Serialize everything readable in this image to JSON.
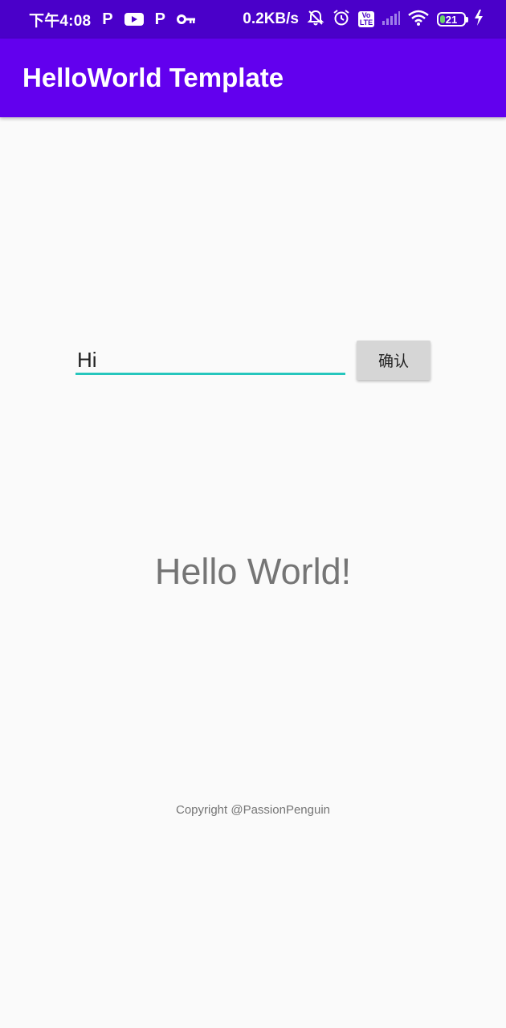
{
  "status_bar": {
    "time": "下午4:08",
    "left_icons": [
      {
        "icon": "p-app-icon",
        "glyph": "P"
      },
      {
        "icon": "youtube-icon",
        "glyph": "▶"
      },
      {
        "icon": "p-app-icon",
        "glyph": "P"
      },
      {
        "icon": "key-icon",
        "glyph": "⚷"
      }
    ],
    "network_speed": "0.2KB/s",
    "right_icons": [
      "bell-off-icon",
      "alarm-icon",
      "volte-icon",
      "signal-icon",
      "wifi-icon",
      "battery-icon",
      "charging-icon"
    ],
    "volte_top": "Vo",
    "volte_bottom": "LTE",
    "battery_level": "21",
    "battery_fraction": 0.21,
    "bg_color": "#4a00c9"
  },
  "app_bar": {
    "title": "HelloWorld Template",
    "bg_color": "#6200ee"
  },
  "main": {
    "input_value": "Hi",
    "input_underline_color": "#26c6bd",
    "confirm_label": "确认",
    "hello_text": "Hello World!",
    "copyright": "Copyright @PassionPenguin"
  }
}
